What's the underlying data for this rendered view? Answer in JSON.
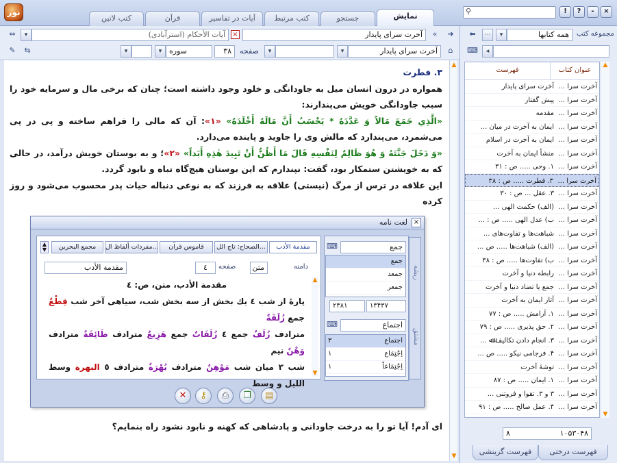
{
  "app": {
    "logo": "نور"
  },
  "tabs": [
    {
      "label": "نمایش",
      "active": true
    },
    {
      "label": "جستجو"
    },
    {
      "label": "کتب مرتبط"
    },
    {
      "label": "آیات در تفاسیر"
    },
    {
      "label": "قرآن"
    },
    {
      "label": "کتب لاتین"
    }
  ],
  "window_buttons": [
    "!",
    "?",
    "-",
    "×"
  ],
  "toolbar": {
    "book_title": "آخرت سرای پایدار",
    "related_book": "آیات الأحکام (استرآبادی)",
    "section_title": "آخرت سرای پایدار",
    "page_label": "صفحه",
    "page_value": "۳۸",
    "surah_label": "سوره"
  },
  "content": {
    "heading": "۳. فطرت",
    "p1": "همواره در درون انسان میل به جاودانگی و خلود وجود داشته است؛ چنان که برخی مال و سرمایه خود را سبب جاودانگی خویش می‌پندارند:",
    "verse1": "«الَّذِي جَمَعَ مَالاً وَ عَدَّدَهُ * يَحْسَبُ أَنَّ مَالَهُ أَخْلَدَهُ»",
    "ref1": "«۱»",
    "p2a": ": آن که مالی را فراهم ساخته و پی در پی می‌شمرد، می‌پندارد که مالش وی را جاوید و پاینده می‌دارد.",
    "verse2": "«وَ دَخَلَ جَنَّتَهُ وَ هُوَ ظَالِمٌ لِنَفْسِهِ قَالَ مَا أَظُنُّ أَنْ تَبِيدَ هٰذِهِ أَبَداً»",
    "ref2": "«۲»",
    "p3a": "؛ و به بوستان خویش درآمد، در حالی که به خویشتن ستمکار بود، گفت: نپندارم که این بوستان هیچ‌گاه تباه و نابود گردد.",
    "p4": "این علاقه در ترس از مرگ (نیستی) علاقه به فرزند که به نوعی دنباله حیات پدر محسوب می‌شود و روز کرده",
    "last": "ای آدم! آیا تو را به درخت جاودانی و پادشاهی که کهنه و نابود نشود راه بنمایم؟"
  },
  "right_panel": {
    "collection_label": "مجموعه کتب",
    "collection_value": "همه کتابها",
    "col_book": "عنوان کتاب",
    "col_index": "فهرست",
    "rows": [
      {
        "book": "آخرت سرا ...",
        "index": "آخرت سرای پایدار"
      },
      {
        "book": "آخرت سرا ...",
        "index": "پیش گفتار"
      },
      {
        "book": "آخرت سرا ...",
        "index": "مقدمه"
      },
      {
        "book": "آخرت سرا ...",
        "index": "ایمان به آخرت در میان ..."
      },
      {
        "book": "آخرت سرا ...",
        "index": "ایمان به آخرت در اسلام"
      },
      {
        "book": "آخرت سرا ...",
        "index": "منشأ ایمان به آخرت"
      },
      {
        "book": "آخرت سرا ...",
        "index": "۱. وحی ..... ص : ۳۱"
      },
      {
        "book": "آخرت سرا ...",
        "index": "۳. فطرت ..... ص : ۳۸",
        "selected": true
      },
      {
        "book": "آخرت سرا ...",
        "index": "۳. عقل ... ص : ۳۰"
      },
      {
        "book": "آخرت سرا ...",
        "index": "(الف) حکمت الهی ..."
      },
      {
        "book": "آخرت سرا ...",
        "index": "ب) عدل الهی ..... ص : ..."
      },
      {
        "book": "آخرت سرا ...",
        "index": "شباهت‌ها و تفاوت‌های ..."
      },
      {
        "book": "آخرت سرا ...",
        "index": "(الف) شباهت‌ها ..... ص ..."
      },
      {
        "book": "آخرت سرا ...",
        "index": "ب) تفاوت‌ها ..... ص : ۳۸"
      },
      {
        "book": "آخرت سرا ...",
        "index": "رابطه دنیا و آخرت"
      },
      {
        "book": "آخرت سرا ...",
        "index": "جمع یا تضاد دنیا و آخرت"
      },
      {
        "book": "آخرت سرا ...",
        "index": "آثار ایمان به آخرت"
      },
      {
        "book": "آخرت سرا ...",
        "index": "۱. آرامش ..... ص : ۷۷"
      },
      {
        "book": "آخرت سرا ...",
        "index": "۲. حق پذیری ..... ص : ۷۹"
      },
      {
        "book": "آخرت سرا ...",
        "index": "۳. انجام دادن تکالیف ﷲ ..."
      },
      {
        "book": "آخرت سرا ...",
        "index": "۴. فرجامی نیکو ..... ص ..."
      },
      {
        "book": "آخرت سرا ...",
        "index": "توشهٔ آخرت"
      },
      {
        "book": "آخرت سرا ...",
        "index": "۱. ایمان ..... ص : ۸۷"
      },
      {
        "book": "آخرت سرا ...",
        "index": "۳ و ۳. تقوا و فروتنی ..."
      },
      {
        "book": "آخرت سرا ...",
        "index": "۴. عمل صالح ..... ص : ۹۱"
      }
    ],
    "status_left": "۸",
    "status_right": "۱۰۵۳۰۴۸",
    "bottom_tabs": [
      "فهرست درختی",
      "فهرست گزینشی"
    ]
  },
  "dialog": {
    "title": "لغت نامه",
    "dict_tabs": [
      "مقدمة الأدب",
      "الصحاح: تاج الل...",
      "قاموس قرآن",
      "مفردات ألفاظ ال...",
      "مجمع البحرين"
    ],
    "range_label": "دامنه",
    "range_value": "متن",
    "page_label": "صفحه",
    "page_value": "٤",
    "source_value": "مقدمة الأدب",
    "heading": "مقدمة الأدب، متن، ص: ٤",
    "line1a": "پارهٔ از شب ٤ يك بخش از سه بخش شب، سياهى آخر شب",
    "line1b": "قِطْعٌ",
    "line1c": "جمع",
    "line1d": "زُلَفَةٌ",
    "line2a": "مترادف",
    "line2b": "زُلَفٌ",
    "line2c": "جمع ٤",
    "line2d": "زُلَفَاتٌ",
    "line2e": "جمع",
    "line2f": "هَزِيعٌ",
    "line2g": "مترادف",
    "line2h": "طَائِفَةٌ",
    "line2i": "مترادف",
    "line2j": "وَهْنٌ",
    "line2k": "نيم",
    "line3a": "شب ٣ ميان شب",
    "line3b": "مَوْهِنٌ",
    "line3c": "مترادف",
    "line3d": "بُهْرَةٌ",
    "line3e": "مترادف ٥",
    "line3f": "البهرة",
    "line3g": "وسط الليل و وسط",
    "side_label1": "ريشه",
    "side_label2": "مشتق",
    "root_input": "جمع",
    "roots": [
      {
        "w": "جمع",
        "selected": true
      },
      {
        "w": "جمعد"
      },
      {
        "w": "جمعر"
      }
    ],
    "root_count_a": "۱۳۴۳۷",
    "root_count_b": "۲۳۸۱",
    "deriv_input": "اجتماع",
    "derivs": [
      {
        "w": "اجتماع",
        "n": "۳",
        "selected": true
      },
      {
        "w": "اِجْتِمَاع",
        "n": "۱"
      },
      {
        "w": "اِجْتِمَاعاً",
        "n": "۱"
      }
    ]
  }
}
